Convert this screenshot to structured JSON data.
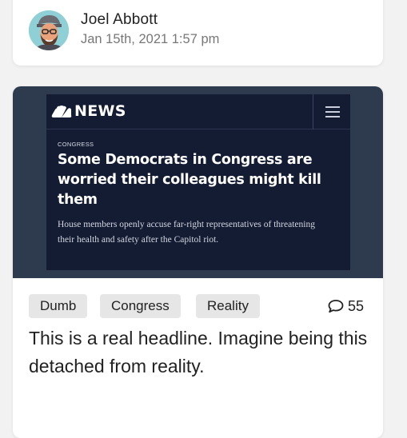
{
  "author": {
    "name": "Joel Abbott",
    "date": "Jan 15th, 2021 1:57 pm"
  },
  "post": {
    "embed": {
      "brand": "NEWS",
      "kicker": "CONGRESS",
      "headline": "Some Democrats in Congress are worried their colleagues might kill them",
      "dek": "House members openly accuse far-right representatives of threatening their health and safety after the Capitol riot."
    },
    "tags": [
      "Dumb",
      "Congress",
      "Reality"
    ],
    "comment_count": "55",
    "text": "This is a real headline. Imagine being this detached from reality."
  },
  "icons": {
    "peacock": "nbc-peacock-icon",
    "menu": "hamburger-menu-icon",
    "comments": "speech-bubble-icon"
  },
  "colors": {
    "media_bg": "#2e3b4f",
    "screenshot_bg": "#141c33",
    "tag_bg": "#e6e6e6"
  }
}
